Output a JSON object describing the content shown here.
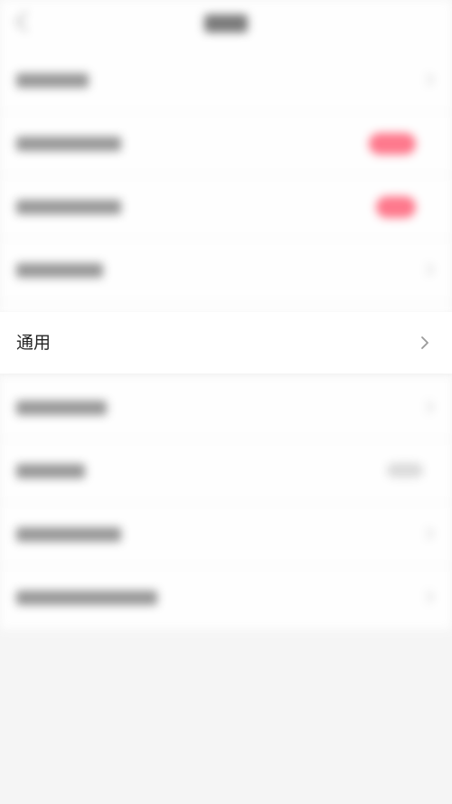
{
  "general_row": {
    "label": "通用",
    "icon": "chevron-right-icon"
  },
  "colors": {
    "accent_toggle": "#ff6b81",
    "background": "#f5f5f5"
  }
}
